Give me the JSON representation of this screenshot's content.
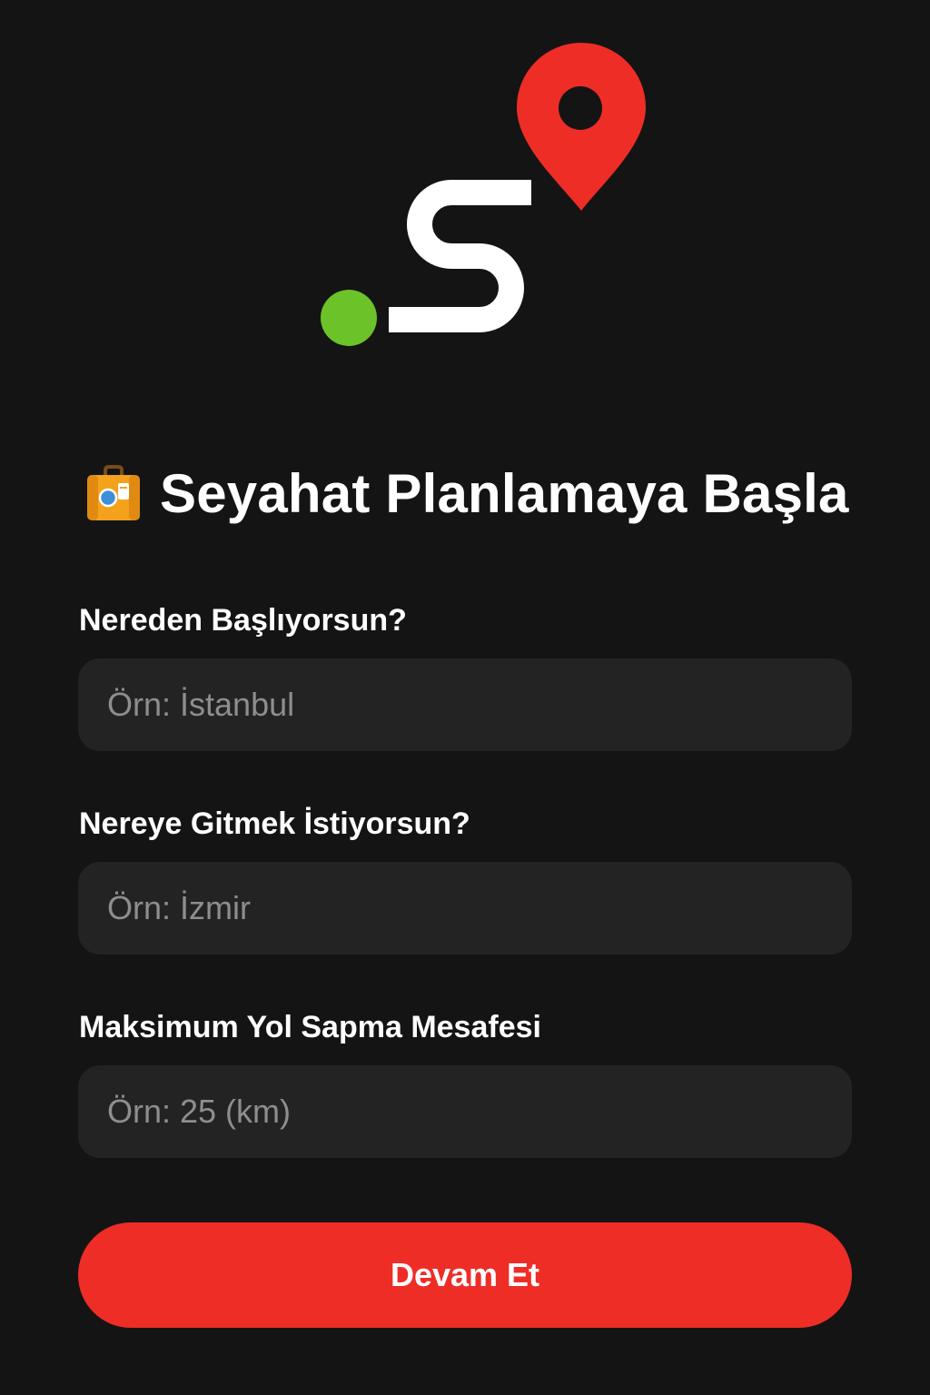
{
  "logo": {
    "icon": "route-logo-icon",
    "pin_color": "#ef2d27",
    "dot_color": "#6cc229",
    "path_color": "#ffffff"
  },
  "header": {
    "icon": "suitcase-icon",
    "title": "Seyahat Planlamaya Başla"
  },
  "form": {
    "from": {
      "label": "Nereden Başlıyorsun?",
      "placeholder": "Örn: İstanbul",
      "value": ""
    },
    "to": {
      "label": "Nereye Gitmek İstiyorsun?",
      "placeholder": "Örn: İzmir",
      "value": ""
    },
    "detour": {
      "label": "Maksimum Yol Sapma Mesafesi",
      "placeholder": "Örn: 25 (km)",
      "value": ""
    }
  },
  "actions": {
    "continue_label": "Devam Et",
    "accent_color": "#ef2d27"
  }
}
